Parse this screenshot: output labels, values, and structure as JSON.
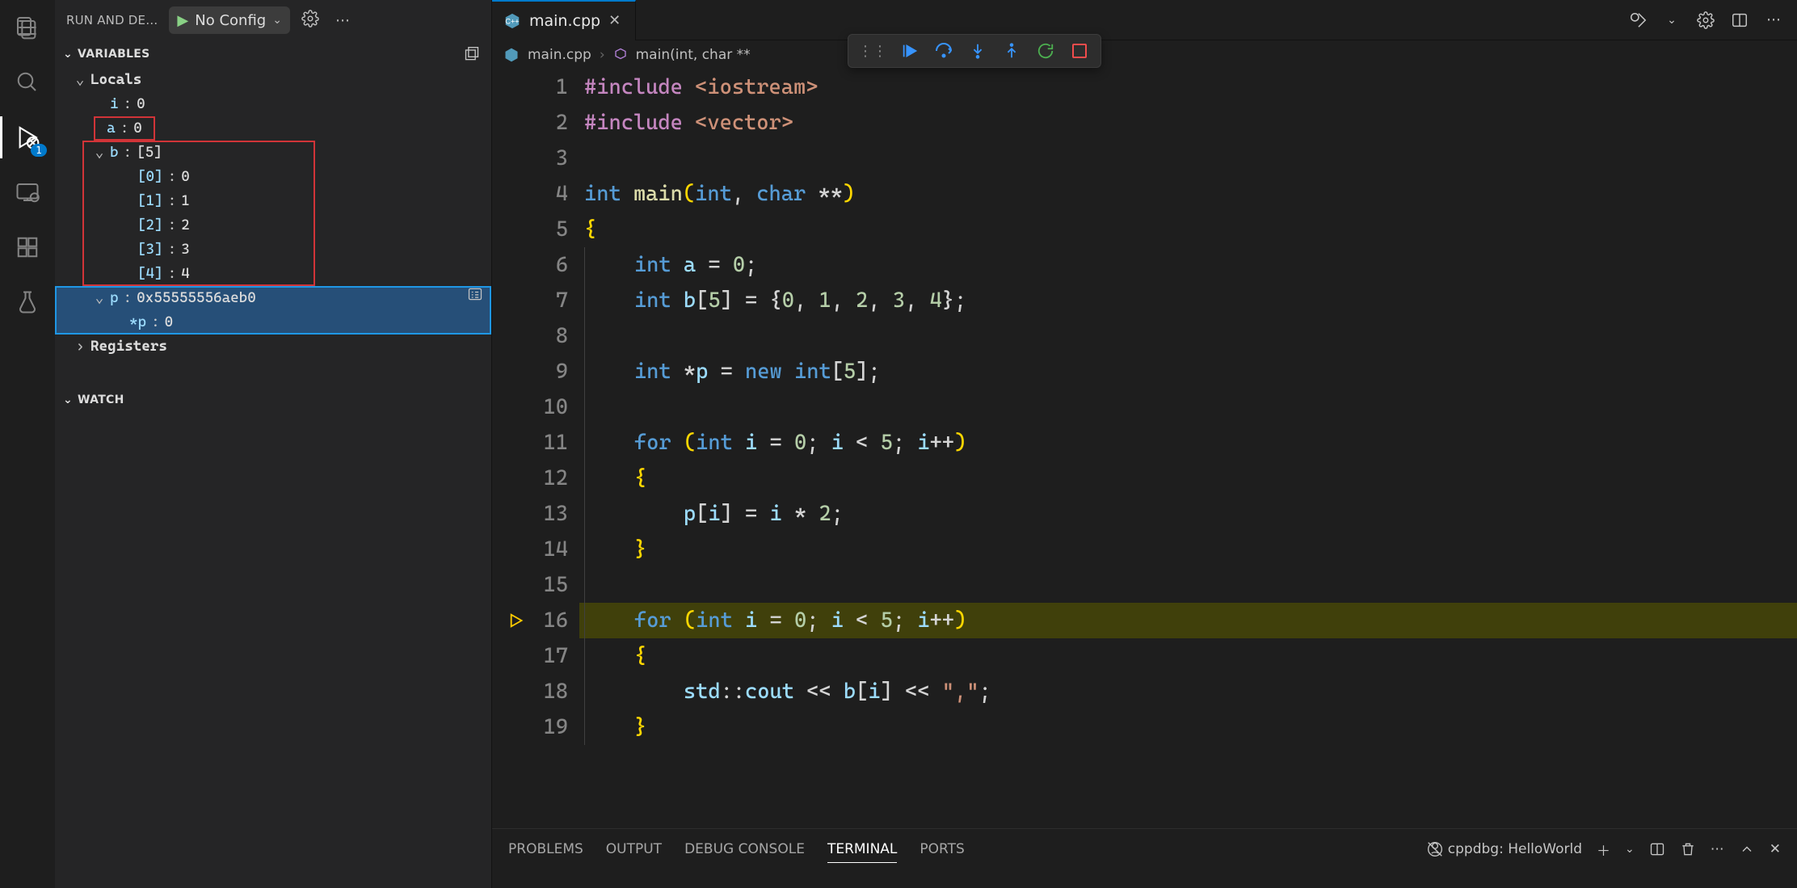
{
  "activity_bar": {
    "badge_count": "1"
  },
  "run_and_debug": {
    "title": "RUN AND DE…",
    "config_name": "No Config"
  },
  "sections": {
    "variables": "VARIABLES",
    "locals": "Locals",
    "registers": "Registers",
    "watch": "WATCH"
  },
  "locals": {
    "i": {
      "name": "i",
      "value": "0"
    },
    "a": {
      "name": "a",
      "value": "0"
    },
    "b": {
      "name": "b",
      "summary": "[5]",
      "items": [
        {
          "idx": "[0]",
          "val": "0"
        },
        {
          "idx": "[1]",
          "val": "1"
        },
        {
          "idx": "[2]",
          "val": "2"
        },
        {
          "idx": "[3]",
          "val": "3"
        },
        {
          "idx": "[4]",
          "val": "4"
        }
      ]
    },
    "p": {
      "name": "p",
      "value": "0x55555556aeb0",
      "deref_name": "*p",
      "deref_value": "0"
    }
  },
  "tab": {
    "filename": "main.cpp"
  },
  "breadcrumb": {
    "file": "main.cpp",
    "symbol": "main(int, char **"
  },
  "editor_actions": {},
  "code": {
    "lines": [
      {
        "n": "1",
        "tokens": [
          [
            "pinc",
            "#include"
          ],
          [
            "op",
            " "
          ],
          [
            "str",
            "<iostream>"
          ]
        ]
      },
      {
        "n": "2",
        "tokens": [
          [
            "pinc",
            "#include"
          ],
          [
            "op",
            " "
          ],
          [
            "str",
            "<vector>"
          ]
        ]
      },
      {
        "n": "3",
        "tokens": [
          [
            "op",
            ""
          ]
        ]
      },
      {
        "n": "4",
        "tokens": [
          [
            "kw",
            "int"
          ],
          [
            "op",
            " "
          ],
          [
            "func",
            "main"
          ],
          [
            "br",
            "("
          ],
          [
            "kw",
            "int"
          ],
          [
            "op",
            ", "
          ],
          [
            "kw",
            "char"
          ],
          [
            "op",
            " **"
          ],
          [
            "br",
            ")"
          ]
        ]
      },
      {
        "n": "5",
        "tokens": [
          [
            "br",
            "{"
          ]
        ]
      },
      {
        "n": "6",
        "indent": 1,
        "tokens": [
          [
            "kw",
            "int"
          ],
          [
            "op",
            " "
          ],
          [
            "var",
            "a"
          ],
          [
            "op",
            " = "
          ],
          [
            "num",
            "0"
          ],
          [
            "op",
            ";"
          ]
        ]
      },
      {
        "n": "7",
        "indent": 1,
        "tokens": [
          [
            "kw",
            "int"
          ],
          [
            "op",
            " "
          ],
          [
            "var",
            "b"
          ],
          [
            "op",
            "["
          ],
          [
            "num",
            "5"
          ],
          [
            "op",
            "] = {"
          ],
          [
            "num",
            "0"
          ],
          [
            "op",
            ", "
          ],
          [
            "num",
            "1"
          ],
          [
            "op",
            ", "
          ],
          [
            "num",
            "2"
          ],
          [
            "op",
            ", "
          ],
          [
            "num",
            "3"
          ],
          [
            "op",
            ", "
          ],
          [
            "num",
            "4"
          ],
          [
            "op",
            "};"
          ]
        ]
      },
      {
        "n": "8",
        "indent": 1,
        "tokens": [
          [
            "op",
            ""
          ]
        ]
      },
      {
        "n": "9",
        "indent": 1,
        "tokens": [
          [
            "kw",
            "int"
          ],
          [
            "op",
            " *"
          ],
          [
            "var",
            "p"
          ],
          [
            "op",
            " = "
          ],
          [
            "kw",
            "new"
          ],
          [
            "op",
            " "
          ],
          [
            "kw",
            "int"
          ],
          [
            "op",
            "["
          ],
          [
            "num",
            "5"
          ],
          [
            "op",
            "];"
          ]
        ]
      },
      {
        "n": "10",
        "indent": 1,
        "tokens": [
          [
            "op",
            ""
          ]
        ]
      },
      {
        "n": "11",
        "indent": 1,
        "tokens": [
          [
            "kw",
            "for"
          ],
          [
            "op",
            " "
          ],
          [
            "br",
            "("
          ],
          [
            "kw",
            "int"
          ],
          [
            "op",
            " "
          ],
          [
            "var",
            "i"
          ],
          [
            "op",
            " = "
          ],
          [
            "num",
            "0"
          ],
          [
            "op",
            "; "
          ],
          [
            "var",
            "i"
          ],
          [
            "op",
            " < "
          ],
          [
            "num",
            "5"
          ],
          [
            "op",
            "; "
          ],
          [
            "var",
            "i"
          ],
          [
            "op",
            "++"
          ],
          [
            "br",
            ")"
          ]
        ]
      },
      {
        "n": "12",
        "indent": 1,
        "tokens": [
          [
            "br",
            "{"
          ]
        ]
      },
      {
        "n": "13",
        "indent": 2,
        "tokens": [
          [
            "var",
            "p"
          ],
          [
            "op",
            "["
          ],
          [
            "var",
            "i"
          ],
          [
            "op",
            "] = "
          ],
          [
            "var",
            "i"
          ],
          [
            "op",
            " * "
          ],
          [
            "num",
            "2"
          ],
          [
            "op",
            ";"
          ]
        ]
      },
      {
        "n": "14",
        "indent": 1,
        "tokens": [
          [
            "br",
            "}"
          ]
        ]
      },
      {
        "n": "15",
        "indent": 1,
        "tokens": [
          [
            "op",
            ""
          ]
        ]
      },
      {
        "n": "16",
        "exec": true,
        "indent": 1,
        "tokens": [
          [
            "kw",
            "for"
          ],
          [
            "op",
            " "
          ],
          [
            "br",
            "("
          ],
          [
            "kw",
            "int"
          ],
          [
            "op",
            " "
          ],
          [
            "var",
            "i"
          ],
          [
            "op",
            " = "
          ],
          [
            "num",
            "0"
          ],
          [
            "op",
            "; "
          ],
          [
            "var",
            "i"
          ],
          [
            "op",
            " < "
          ],
          [
            "num",
            "5"
          ],
          [
            "op",
            "; "
          ],
          [
            "var",
            "i"
          ],
          [
            "op",
            "++"
          ],
          [
            "br",
            ")"
          ]
        ]
      },
      {
        "n": "17",
        "indent": 1,
        "tokens": [
          [
            "br",
            "{"
          ]
        ]
      },
      {
        "n": "18",
        "indent": 2,
        "tokens": [
          [
            "var",
            "std"
          ],
          [
            "op",
            "::"
          ],
          [
            "var",
            "cout"
          ],
          [
            "op",
            " << "
          ],
          [
            "var",
            "b"
          ],
          [
            "op",
            "["
          ],
          [
            "var",
            "i"
          ],
          [
            "op",
            "] << "
          ],
          [
            "str",
            "\",\""
          ],
          [
            "op",
            ";"
          ]
        ]
      },
      {
        "n": "19",
        "indent": 1,
        "tokens": [
          [
            "br",
            "}"
          ]
        ]
      }
    ]
  },
  "panel": {
    "tabs": [
      "PROBLEMS",
      "OUTPUT",
      "DEBUG CONSOLE",
      "TERMINAL",
      "PORTS"
    ],
    "active_tab_index": 3,
    "launch_label": "cppdbg: HelloWorld"
  }
}
